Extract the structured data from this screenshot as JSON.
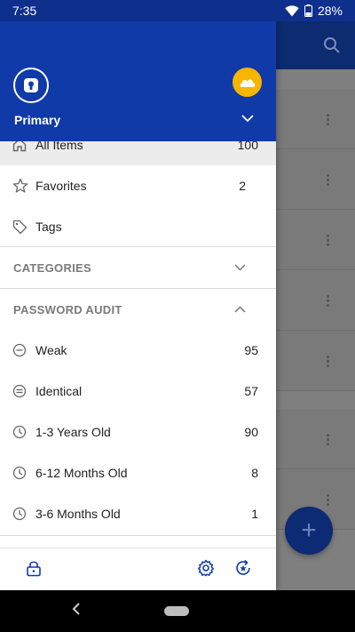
{
  "status_bar": {
    "time": "7:35",
    "battery": "28%"
  },
  "drawer": {
    "vault_name": "Primary",
    "items": [
      {
        "label": "All Items",
        "count": "100",
        "icon": "home-icon"
      },
      {
        "label": "Favorites",
        "count": "2",
        "icon": "star-icon"
      },
      {
        "label": "Tags",
        "count": "",
        "icon": "tag-icon"
      }
    ],
    "categories_title": "CATEGORIES",
    "audit_title": "PASSWORD AUDIT",
    "audit_items": [
      {
        "label": "Weak",
        "count": "95",
        "icon": "minus-circle-icon"
      },
      {
        "label": "Identical",
        "count": "57",
        "icon": "equals-circle-icon"
      },
      {
        "label": "1-3 Years Old",
        "count": "90",
        "icon": "clock-icon"
      },
      {
        "label": "6-12 Months Old",
        "count": "8",
        "icon": "clock-icon"
      },
      {
        "label": "3-6 Months Old",
        "count": "1",
        "icon": "clock-icon"
      }
    ]
  },
  "fab": {
    "label": "+"
  },
  "colors": {
    "header": "#0f3aa8",
    "status_bar": "#0f2f8c",
    "avatar": "#f7b500"
  }
}
